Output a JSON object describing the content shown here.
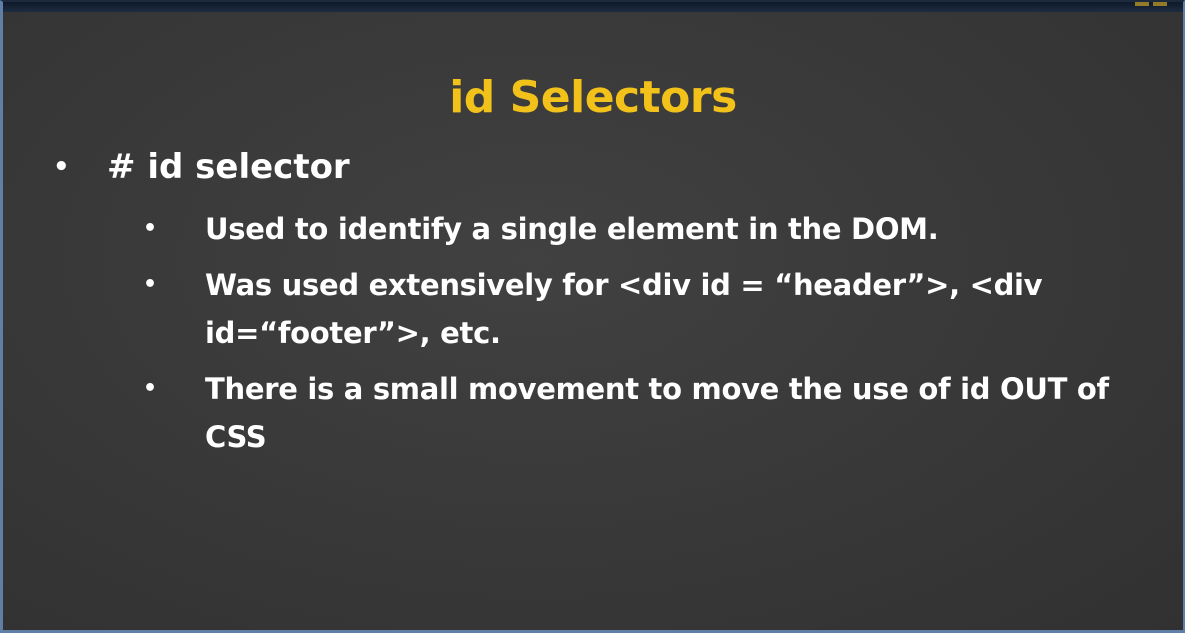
{
  "slide": {
    "title": "id Selectors",
    "bullet": {
      "marker": "•",
      "text": "# id selector"
    },
    "sub_bullets": [
      {
        "marker": "•",
        "text": "Used to identify a single element in the DOM."
      },
      {
        "marker": "•",
        "text": "Was used extensively for <div id = “header”>, <div id=“footer”>, etc."
      },
      {
        "marker": "•",
        "text": "There is a small movement to move the use of id OUT of CSS"
      }
    ]
  },
  "colors": {
    "title": "#f2c21a",
    "text": "#ffffff",
    "background": "#3a3a3a"
  }
}
